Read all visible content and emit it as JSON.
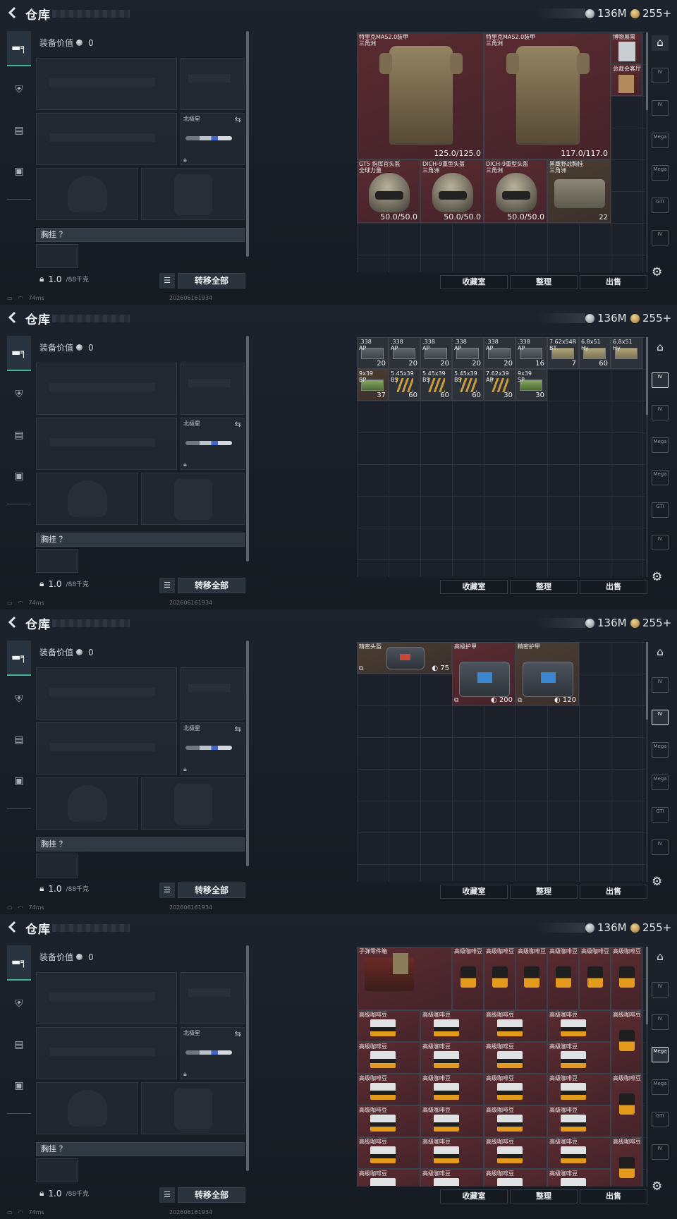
{
  "screen": {
    "title": "仓库",
    "silver": "136M",
    "gold": "255+",
    "equip_value_label": "装备价值",
    "equip_value": "0",
    "knife_label": "北极星",
    "chest_label": "胸挂 ？",
    "weight": "1.0",
    "weight_max": "/88千克",
    "transfer_label": "转移全部",
    "btn_collection": "收藏室",
    "btn_sort": "整理",
    "btn_sell": "出售",
    "ping": "74ms",
    "timestamp": "202606161934"
  },
  "right_tabs": [
    "",
    "IV",
    "IV",
    "Mega",
    "Mega",
    "GTI",
    "IV"
  ],
  "panels": [
    {
      "active_right_tab": 0,
      "items": [
        {
          "name": "特里克MAS2.0装甲\n三角洲",
          "kind": "vest",
          "bg": "red",
          "col": 0,
          "row": 0,
          "w": 4,
          "h": 4,
          "dura": "125.0/125.0"
        },
        {
          "name": "特里克MAS2.0装甲\n三角洲",
          "kind": "vest",
          "bg": "red",
          "col": 4,
          "row": 0,
          "w": 4,
          "h": 4,
          "dura": "117.0/117.0"
        },
        {
          "name": "博物展票",
          "kind": "ticket",
          "bg": "red",
          "col": 8,
          "row": 0,
          "w": 1,
          "h": 1
        },
        {
          "name": "总裁会客厅",
          "kind": "card",
          "bg": "red",
          "col": 8,
          "row": 1,
          "w": 1,
          "h": 1
        },
        {
          "name": "GT5 指挥官头盔\n全球力量",
          "kind": "helmet",
          "bg": "red",
          "col": 0,
          "row": 4,
          "w": 2,
          "h": 2,
          "dura": "50.0/50.0"
        },
        {
          "name": "DICH-9重型头盔\n三角洲",
          "kind": "helmet",
          "bg": "red",
          "col": 2,
          "row": 4,
          "w": 2,
          "h": 2,
          "dura": "50.0/50.0"
        },
        {
          "name": "DICH-9重型头盔\n三角洲",
          "kind": "helmet",
          "bg": "red",
          "col": 4,
          "row": 4,
          "w": 2,
          "h": 2,
          "dura": "50.0/50.0"
        },
        {
          "name": "黑鹰野战胸挂\n三角洲",
          "kind": "rig",
          "bg": "brown",
          "col": 6,
          "row": 4,
          "w": 2,
          "h": 2,
          "qty": "22"
        }
      ]
    },
    {
      "active_right_tab": 1,
      "items": [
        {
          "name": ".338\nAP",
          "kind": "ammo",
          "bg": "gray",
          "col": 0,
          "row": 0,
          "w": 1,
          "h": 1,
          "qty": "20"
        },
        {
          "name": ".338\nAP",
          "kind": "ammo",
          "bg": "gray",
          "col": 1,
          "row": 0,
          "w": 1,
          "h": 1,
          "qty": "20"
        },
        {
          "name": ".338\nAP",
          "kind": "ammo",
          "bg": "gray",
          "col": 2,
          "row": 0,
          "w": 1,
          "h": 1,
          "qty": "20"
        },
        {
          "name": ".338\nAP",
          "kind": "ammo",
          "bg": "gray",
          "col": 3,
          "row": 0,
          "w": 1,
          "h": 1,
          "qty": "20"
        },
        {
          "name": ".338\nAP",
          "kind": "ammo",
          "bg": "gray",
          "col": 4,
          "row": 0,
          "w": 1,
          "h": 1,
          "qty": "20"
        },
        {
          "name": ".338\nAP",
          "kind": "ammo",
          "bg": "gray",
          "col": 5,
          "row": 0,
          "w": 1,
          "h": 1,
          "qty": "16"
        },
        {
          "name": "7.62x54R\nBT",
          "kind": "ammo-tan",
          "bg": "gray",
          "col": 6,
          "row": 0,
          "w": 1,
          "h": 1,
          "qty": "7"
        },
        {
          "name": "6.8x51\nHy",
          "kind": "ammo-tan",
          "bg": "gray",
          "col": 7,
          "row": 0,
          "w": 1,
          "h": 1,
          "qty": "60"
        },
        {
          "name": "6.8x51\nHy",
          "kind": "ammo-tan",
          "bg": "gray",
          "col": 8,
          "row": 0,
          "w": 1,
          "h": 1,
          "qty": ""
        },
        {
          "name": "9x39\nBP",
          "kind": "ammo-green",
          "bg": "brown",
          "col": 0,
          "row": 1,
          "w": 1,
          "h": 1,
          "qty": "37"
        },
        {
          "name": "5.45x39\nBS",
          "kind": "rounds",
          "bg": "gray",
          "col": 1,
          "row": 1,
          "w": 1,
          "h": 1,
          "qty": "60"
        },
        {
          "name": "5.45x39\nBS",
          "kind": "rounds",
          "bg": "gray",
          "col": 2,
          "row": 1,
          "w": 1,
          "h": 1,
          "qty": "60"
        },
        {
          "name": "5.45x39\nBS",
          "kind": "rounds",
          "bg": "gray",
          "col": 3,
          "row": 1,
          "w": 1,
          "h": 1,
          "qty": "60"
        },
        {
          "name": "7.62x39\nAP",
          "kind": "rounds",
          "bg": "gray",
          "col": 4,
          "row": 1,
          "w": 1,
          "h": 1,
          "qty": "30"
        },
        {
          "name": "9x39\nSP",
          "kind": "ammo-green",
          "bg": "gray",
          "col": 5,
          "row": 1,
          "w": 1,
          "h": 1,
          "qty": "30"
        }
      ]
    },
    {
      "active_right_tab": 2,
      "items": [
        {
          "name": "精密头盔",
          "kind": "case-red",
          "bg": "brown",
          "col": 0,
          "row": 0,
          "w": 3,
          "h": 1,
          "shield": "75"
        },
        {
          "name": "高级护甲",
          "kind": "case",
          "bg": "red",
          "col": 3,
          "row": 0,
          "w": 2,
          "h": 2,
          "shield": "200"
        },
        {
          "name": "精密护甲",
          "kind": "case",
          "bg": "brown",
          "col": 5,
          "row": 0,
          "w": 2,
          "h": 2,
          "shield": "120"
        }
      ]
    },
    {
      "active_right_tab": 3,
      "items": [
        {
          "name": "子弹零件箱",
          "kind": "kit",
          "bg": "red",
          "col": 0,
          "row": 0,
          "w": 3,
          "h": 2
        },
        {
          "name": "高级咖啡豆",
          "kind": "coffee-bag",
          "bg": "red",
          "col": 3,
          "row": 0,
          "w": 1,
          "h": 2
        },
        {
          "name": "高级咖啡豆",
          "kind": "coffee-bag",
          "bg": "red",
          "col": 4,
          "row": 0,
          "w": 1,
          "h": 2
        },
        {
          "name": "高级咖啡豆",
          "kind": "coffee-bag",
          "bg": "red",
          "col": 5,
          "row": 0,
          "w": 1,
          "h": 2
        },
        {
          "name": "高级咖啡豆",
          "kind": "coffee-bag",
          "bg": "red",
          "col": 6,
          "row": 0,
          "w": 1,
          "h": 2
        },
        {
          "name": "高级咖啡豆",
          "kind": "coffee-bag",
          "bg": "red",
          "col": 7,
          "row": 0,
          "w": 1,
          "h": 2
        },
        {
          "name": "高级咖啡豆",
          "kind": "coffee-bag",
          "bg": "red",
          "col": 8,
          "row": 0,
          "w": 1,
          "h": 2
        },
        {
          "name": "高级咖啡豆",
          "kind": "coffee-box",
          "bg": "red",
          "col": 0,
          "row": 2,
          "w": 2,
          "h": 1
        },
        {
          "name": "高级咖啡豆",
          "kind": "coffee-box",
          "bg": "red",
          "col": 2,
          "row": 2,
          "w": 2,
          "h": 1
        },
        {
          "name": "高级咖啡豆",
          "kind": "coffee-box",
          "bg": "red",
          "col": 4,
          "row": 2,
          "w": 2,
          "h": 1
        },
        {
          "name": "高级咖啡豆",
          "kind": "coffee-box",
          "bg": "red",
          "col": 6,
          "row": 2,
          "w": 2,
          "h": 1
        },
        {
          "name": "高级咖啡豆",
          "kind": "coffee-bag",
          "bg": "red",
          "col": 8,
          "row": 2,
          "w": 1,
          "h": 2
        },
        {
          "name": "高级咖啡豆",
          "kind": "coffee-box",
          "bg": "red",
          "col": 0,
          "row": 3,
          "w": 2,
          "h": 1
        },
        {
          "name": "高级咖啡豆",
          "kind": "coffee-box",
          "bg": "red",
          "col": 2,
          "row": 3,
          "w": 2,
          "h": 1
        },
        {
          "name": "高级咖啡豆",
          "kind": "coffee-box",
          "bg": "red",
          "col": 4,
          "row": 3,
          "w": 2,
          "h": 1
        },
        {
          "name": "高级咖啡豆",
          "kind": "coffee-box",
          "bg": "red",
          "col": 6,
          "row": 3,
          "w": 2,
          "h": 1
        },
        {
          "name": "高级咖啡豆",
          "kind": "coffee-box",
          "bg": "red",
          "col": 0,
          "row": 4,
          "w": 2,
          "h": 1
        },
        {
          "name": "高级咖啡豆",
          "kind": "coffee-box",
          "bg": "red",
          "col": 2,
          "row": 4,
          "w": 2,
          "h": 1
        },
        {
          "name": "高级咖啡豆",
          "kind": "coffee-box",
          "bg": "red",
          "col": 4,
          "row": 4,
          "w": 2,
          "h": 1
        },
        {
          "name": "高级咖啡豆",
          "kind": "coffee-box",
          "bg": "red",
          "col": 6,
          "row": 4,
          "w": 2,
          "h": 1
        },
        {
          "name": "高级咖啡豆",
          "kind": "coffee-bag",
          "bg": "red",
          "col": 8,
          "row": 4,
          "w": 1,
          "h": 2
        },
        {
          "name": "高级咖啡豆",
          "kind": "coffee-box",
          "bg": "red",
          "col": 0,
          "row": 5,
          "w": 2,
          "h": 1
        },
        {
          "name": "高级咖啡豆",
          "kind": "coffee-box",
          "bg": "red",
          "col": 2,
          "row": 5,
          "w": 2,
          "h": 1
        },
        {
          "name": "高级咖啡豆",
          "kind": "coffee-box",
          "bg": "red",
          "col": 4,
          "row": 5,
          "w": 2,
          "h": 1
        },
        {
          "name": "高级咖啡豆",
          "kind": "coffee-box",
          "bg": "red",
          "col": 6,
          "row": 5,
          "w": 2,
          "h": 1
        },
        {
          "name": "高级咖啡豆",
          "kind": "coffee-box",
          "bg": "red",
          "col": 0,
          "row": 6,
          "w": 2,
          "h": 1
        },
        {
          "name": "高级咖啡豆",
          "kind": "coffee-box",
          "bg": "red",
          "col": 2,
          "row": 6,
          "w": 2,
          "h": 1
        },
        {
          "name": "高级咖啡豆",
          "kind": "coffee-box",
          "bg": "red",
          "col": 4,
          "row": 6,
          "w": 2,
          "h": 1
        },
        {
          "name": "高级咖啡豆",
          "kind": "coffee-box",
          "bg": "red",
          "col": 6,
          "row": 6,
          "w": 2,
          "h": 1
        },
        {
          "name": "高级咖啡豆",
          "kind": "coffee-bag",
          "bg": "red",
          "col": 8,
          "row": 6,
          "w": 1,
          "h": 2
        },
        {
          "name": "高级咖啡豆",
          "kind": "coffee-box",
          "bg": "red",
          "col": 0,
          "row": 7,
          "w": 2,
          "h": 1
        },
        {
          "name": "高级咖啡豆",
          "kind": "coffee-box",
          "bg": "red",
          "col": 2,
          "row": 7,
          "w": 2,
          "h": 1
        },
        {
          "name": "高级咖啡豆",
          "kind": "coffee-box",
          "bg": "red",
          "col": 4,
          "row": 7,
          "w": 2,
          "h": 1
        },
        {
          "name": "高级咖啡豆",
          "kind": "coffee-box",
          "bg": "red",
          "col": 6,
          "row": 7,
          "w": 2,
          "h": 1
        }
      ]
    }
  ]
}
